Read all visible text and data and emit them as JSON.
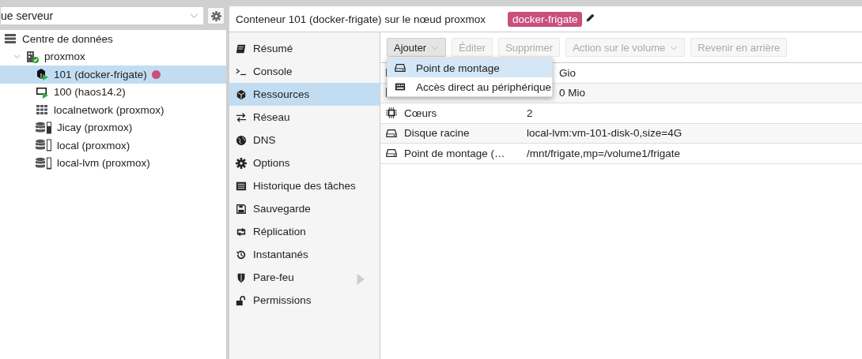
{
  "view_selector": {
    "value": "ue serveur"
  },
  "tree": [
    {
      "label": "Centre de données",
      "kind": "datacenter",
      "selected": false,
      "children": [
        {
          "label": "proxmox",
          "kind": "node",
          "selected": false,
          "expanded": true,
          "children": [
            {
              "label": "101 (docker-frigate)",
              "kind": "container",
              "selected": true,
              "color": "#c94f7c"
            },
            {
              "label": "100 (haos14.2)",
              "kind": "vm",
              "selected": false
            },
            {
              "label": "localnetwork (proxmox)",
              "kind": "network",
              "selected": false
            },
            {
              "label": "Jicay (proxmox)",
              "kind": "storage",
              "selected": false,
              "level": 0.7
            },
            {
              "label": "local (proxmox)",
              "kind": "storage",
              "selected": false,
              "level": 0.05
            },
            {
              "label": "local-lvm (proxmox)",
              "kind": "storage",
              "selected": false,
              "level": 0.1
            }
          ]
        }
      ]
    }
  ],
  "header": {
    "title": "Conteneur 101 (docker-frigate) sur le nœud proxmox",
    "tag": {
      "label": "docker-frigate",
      "color": "#c94f7c"
    }
  },
  "nav": [
    {
      "label": "Résumé",
      "selected": false
    },
    {
      "label": "Console",
      "selected": false
    },
    {
      "label": "Ressources",
      "selected": true
    },
    {
      "label": "Réseau",
      "selected": false
    },
    {
      "label": "DNS",
      "selected": false
    },
    {
      "label": "Options",
      "selected": false
    },
    {
      "label": "Historique des tâches",
      "selected": false
    },
    {
      "label": "Sauvegarde",
      "selected": false
    },
    {
      "label": "Réplication",
      "selected": false
    },
    {
      "label": "Instantanés",
      "selected": false
    },
    {
      "label": "Pare-feu",
      "selected": false,
      "expanded": false
    },
    {
      "label": "Permissions",
      "selected": false
    }
  ],
  "toolbar": [
    {
      "label": "Ajouter",
      "disabled": false,
      "dropdown": true
    },
    {
      "label": "Éditer",
      "disabled": true,
      "dropdown": false
    },
    {
      "label": "Supprimer",
      "disabled": true,
      "dropdown": false
    },
    {
      "label": "Action sur le volume",
      "disabled": true,
      "dropdown": true
    },
    {
      "label": "Revenir en arrière",
      "disabled": true,
      "dropdown": false
    }
  ],
  "table": {
    "rows": [
      {
        "value": "Gio"
      },
      {
        "value": "0 Mio"
      },
      {
        "name": "Cœurs",
        "value": "2"
      },
      {
        "name": "Disque racine",
        "value": "local-lvm:vm-101-disk-0,size=4G"
      },
      {
        "name": "Point de montage (…",
        "value": "/mnt/frigate,mp=/volume1/frigate"
      }
    ]
  },
  "add_menu": [
    {
      "label": "Point de montage",
      "selected": true
    },
    {
      "label": "Accès direct au périphérique",
      "selected": false
    }
  ]
}
